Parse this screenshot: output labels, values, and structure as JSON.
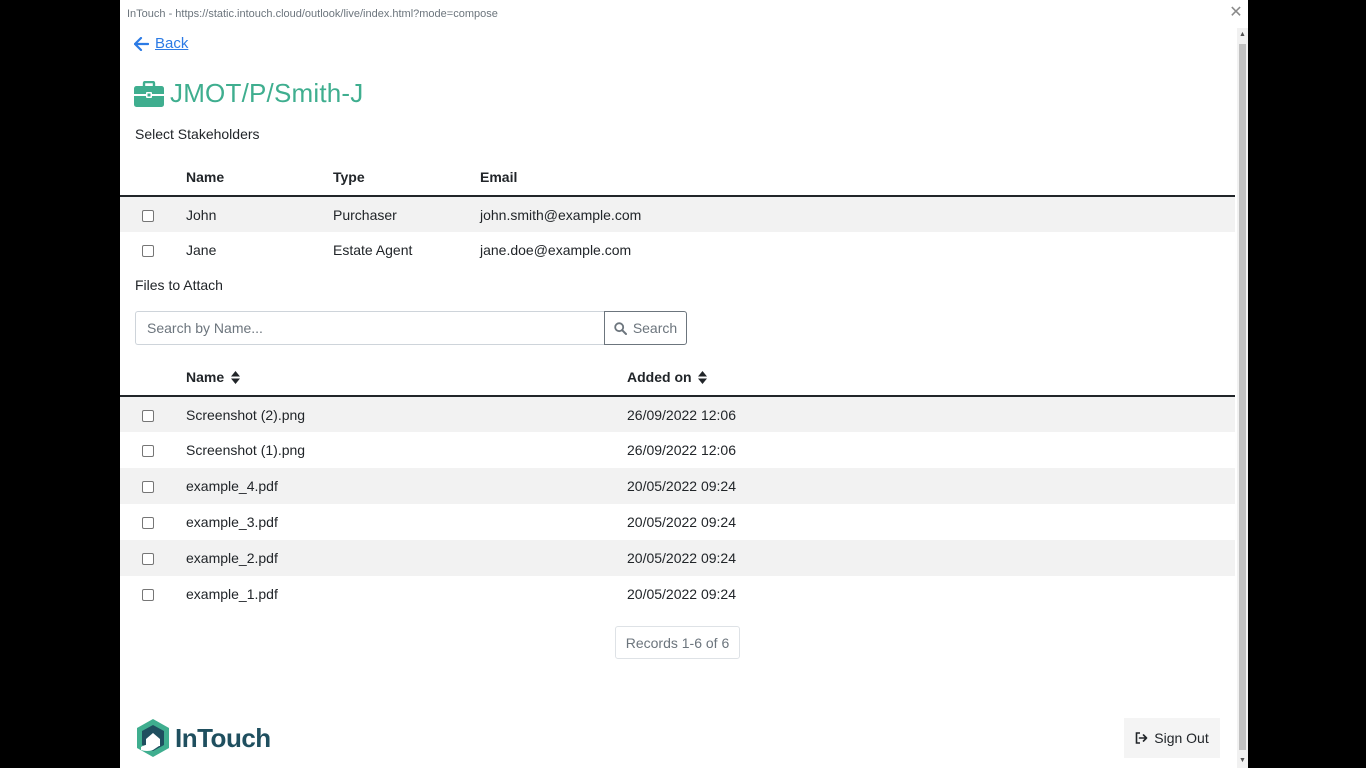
{
  "window": {
    "url": "InTouch - https://static.intouch.cloud/outlook/live/index.html?mode=compose",
    "close_glyph": "✕"
  },
  "nav": {
    "back_label": "Back"
  },
  "matter": {
    "title": "JMOT/P/Smith-J",
    "icon": "briefcase-icon",
    "color": "#3fae8f"
  },
  "stakeholders": {
    "section_label": "Select Stakeholders",
    "columns": [
      "Name",
      "Type",
      "Email"
    ],
    "rows": [
      {
        "name": "John",
        "type": "Purchaser",
        "email": "john.smith@example.com",
        "checked": false
      },
      {
        "name": "Jane",
        "type": "Estate Agent",
        "email": "jane.doe@example.com",
        "checked": false
      }
    ]
  },
  "files": {
    "section_label": "Files to Attach",
    "search_placeholder": "Search by Name...",
    "search_button": "Search",
    "columns": [
      "Name",
      "Added on"
    ],
    "rows": [
      {
        "name": "Screenshot (2).png",
        "added": "26/09/2022 12:06",
        "checked": false
      },
      {
        "name": "Screenshot (1).png",
        "added": "26/09/2022 12:06",
        "checked": false
      },
      {
        "name": "example_4.pdf",
        "added": "20/05/2022 09:24",
        "checked": false
      },
      {
        "name": "example_3.pdf",
        "added": "20/05/2022 09:24",
        "checked": false
      },
      {
        "name": "example_2.pdf",
        "added": "20/05/2022 09:24",
        "checked": false
      },
      {
        "name": "example_1.pdf",
        "added": "20/05/2022 09:24",
        "checked": false
      }
    ],
    "records_label": "Records 1-6 of 6"
  },
  "footer": {
    "brand": "InTouch",
    "signout_label": "Sign Out"
  },
  "colors": {
    "accent": "#3fae8f",
    "link": "#2c7be5",
    "brand_dark": "#1f4f5f"
  }
}
